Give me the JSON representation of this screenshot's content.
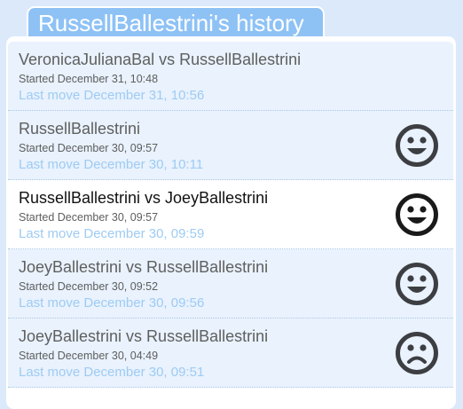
{
  "header": {
    "title": "RussellBallestrini's history"
  },
  "colors": {
    "page_bg": "#dbe9fb",
    "tab_bg": "#8ec2f5",
    "row_bg": "#e9f2fd",
    "selected_row_bg": "#ffffff",
    "last_move_text": "#9ecbf3",
    "face_icon": "#3c3e42",
    "face_icon_selected": "#1a1a1a"
  },
  "games": [
    {
      "title": "VeronicaJulianaBal vs RussellBallestrini",
      "started": "Started December 31, 10:48",
      "last_move": "Last move December 31, 10:56",
      "face": null,
      "selected": false
    },
    {
      "title": "RussellBallestrini",
      "started": "Started December 30, 09:57",
      "last_move": "Last move December 30, 10:11",
      "face": "happy-face-icon",
      "selected": false
    },
    {
      "title": "RussellBallestrini vs JoeyBallestrini",
      "started": "Started December 30, 09:57",
      "last_move": "Last move December 30, 09:59",
      "face": "happy-face-icon",
      "selected": true
    },
    {
      "title": "JoeyBallestrini vs RussellBallestrini",
      "started": "Started December 30, 09:52",
      "last_move": "Last move December 30, 09:56",
      "face": "happy-face-icon",
      "selected": false
    },
    {
      "title": "JoeyBallestrini vs RussellBallestrini",
      "started": "Started December 30, 04:49",
      "last_move": "Last move December 30, 09:51",
      "face": "sad-face-icon",
      "selected": false
    }
  ]
}
